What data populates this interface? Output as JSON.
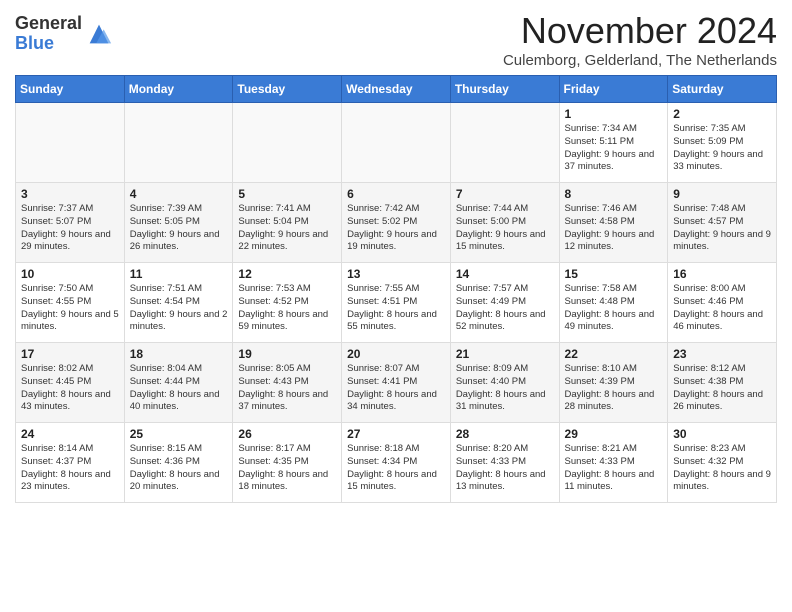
{
  "logo": {
    "general": "General",
    "blue": "Blue"
  },
  "header": {
    "month": "November 2024",
    "location": "Culemborg, Gelderland, The Netherlands"
  },
  "weekdays": [
    "Sunday",
    "Monday",
    "Tuesday",
    "Wednesday",
    "Thursday",
    "Friday",
    "Saturday"
  ],
  "weeks": [
    [
      {
        "day": "",
        "info": ""
      },
      {
        "day": "",
        "info": ""
      },
      {
        "day": "",
        "info": ""
      },
      {
        "day": "",
        "info": ""
      },
      {
        "day": "",
        "info": ""
      },
      {
        "day": "1",
        "info": "Sunrise: 7:34 AM\nSunset: 5:11 PM\nDaylight: 9 hours and 37 minutes."
      },
      {
        "day": "2",
        "info": "Sunrise: 7:35 AM\nSunset: 5:09 PM\nDaylight: 9 hours and 33 minutes."
      }
    ],
    [
      {
        "day": "3",
        "info": "Sunrise: 7:37 AM\nSunset: 5:07 PM\nDaylight: 9 hours and 29 minutes."
      },
      {
        "day": "4",
        "info": "Sunrise: 7:39 AM\nSunset: 5:05 PM\nDaylight: 9 hours and 26 minutes."
      },
      {
        "day": "5",
        "info": "Sunrise: 7:41 AM\nSunset: 5:04 PM\nDaylight: 9 hours and 22 minutes."
      },
      {
        "day": "6",
        "info": "Sunrise: 7:42 AM\nSunset: 5:02 PM\nDaylight: 9 hours and 19 minutes."
      },
      {
        "day": "7",
        "info": "Sunrise: 7:44 AM\nSunset: 5:00 PM\nDaylight: 9 hours and 15 minutes."
      },
      {
        "day": "8",
        "info": "Sunrise: 7:46 AM\nSunset: 4:58 PM\nDaylight: 9 hours and 12 minutes."
      },
      {
        "day": "9",
        "info": "Sunrise: 7:48 AM\nSunset: 4:57 PM\nDaylight: 9 hours and 9 minutes."
      }
    ],
    [
      {
        "day": "10",
        "info": "Sunrise: 7:50 AM\nSunset: 4:55 PM\nDaylight: 9 hours and 5 minutes."
      },
      {
        "day": "11",
        "info": "Sunrise: 7:51 AM\nSunset: 4:54 PM\nDaylight: 9 hours and 2 minutes."
      },
      {
        "day": "12",
        "info": "Sunrise: 7:53 AM\nSunset: 4:52 PM\nDaylight: 8 hours and 59 minutes."
      },
      {
        "day": "13",
        "info": "Sunrise: 7:55 AM\nSunset: 4:51 PM\nDaylight: 8 hours and 55 minutes."
      },
      {
        "day": "14",
        "info": "Sunrise: 7:57 AM\nSunset: 4:49 PM\nDaylight: 8 hours and 52 minutes."
      },
      {
        "day": "15",
        "info": "Sunrise: 7:58 AM\nSunset: 4:48 PM\nDaylight: 8 hours and 49 minutes."
      },
      {
        "day": "16",
        "info": "Sunrise: 8:00 AM\nSunset: 4:46 PM\nDaylight: 8 hours and 46 minutes."
      }
    ],
    [
      {
        "day": "17",
        "info": "Sunrise: 8:02 AM\nSunset: 4:45 PM\nDaylight: 8 hours and 43 minutes."
      },
      {
        "day": "18",
        "info": "Sunrise: 8:04 AM\nSunset: 4:44 PM\nDaylight: 8 hours and 40 minutes."
      },
      {
        "day": "19",
        "info": "Sunrise: 8:05 AM\nSunset: 4:43 PM\nDaylight: 8 hours and 37 minutes."
      },
      {
        "day": "20",
        "info": "Sunrise: 8:07 AM\nSunset: 4:41 PM\nDaylight: 8 hours and 34 minutes."
      },
      {
        "day": "21",
        "info": "Sunrise: 8:09 AM\nSunset: 4:40 PM\nDaylight: 8 hours and 31 minutes."
      },
      {
        "day": "22",
        "info": "Sunrise: 8:10 AM\nSunset: 4:39 PM\nDaylight: 8 hours and 28 minutes."
      },
      {
        "day": "23",
        "info": "Sunrise: 8:12 AM\nSunset: 4:38 PM\nDaylight: 8 hours and 26 minutes."
      }
    ],
    [
      {
        "day": "24",
        "info": "Sunrise: 8:14 AM\nSunset: 4:37 PM\nDaylight: 8 hours and 23 minutes."
      },
      {
        "day": "25",
        "info": "Sunrise: 8:15 AM\nSunset: 4:36 PM\nDaylight: 8 hours and 20 minutes."
      },
      {
        "day": "26",
        "info": "Sunrise: 8:17 AM\nSunset: 4:35 PM\nDaylight: 8 hours and 18 minutes."
      },
      {
        "day": "27",
        "info": "Sunrise: 8:18 AM\nSunset: 4:34 PM\nDaylight: 8 hours and 15 minutes."
      },
      {
        "day": "28",
        "info": "Sunrise: 8:20 AM\nSunset: 4:33 PM\nDaylight: 8 hours and 13 minutes."
      },
      {
        "day": "29",
        "info": "Sunrise: 8:21 AM\nSunset: 4:33 PM\nDaylight: 8 hours and 11 minutes."
      },
      {
        "day": "30",
        "info": "Sunrise: 8:23 AM\nSunset: 4:32 PM\nDaylight: 8 hours and 9 minutes."
      }
    ]
  ]
}
